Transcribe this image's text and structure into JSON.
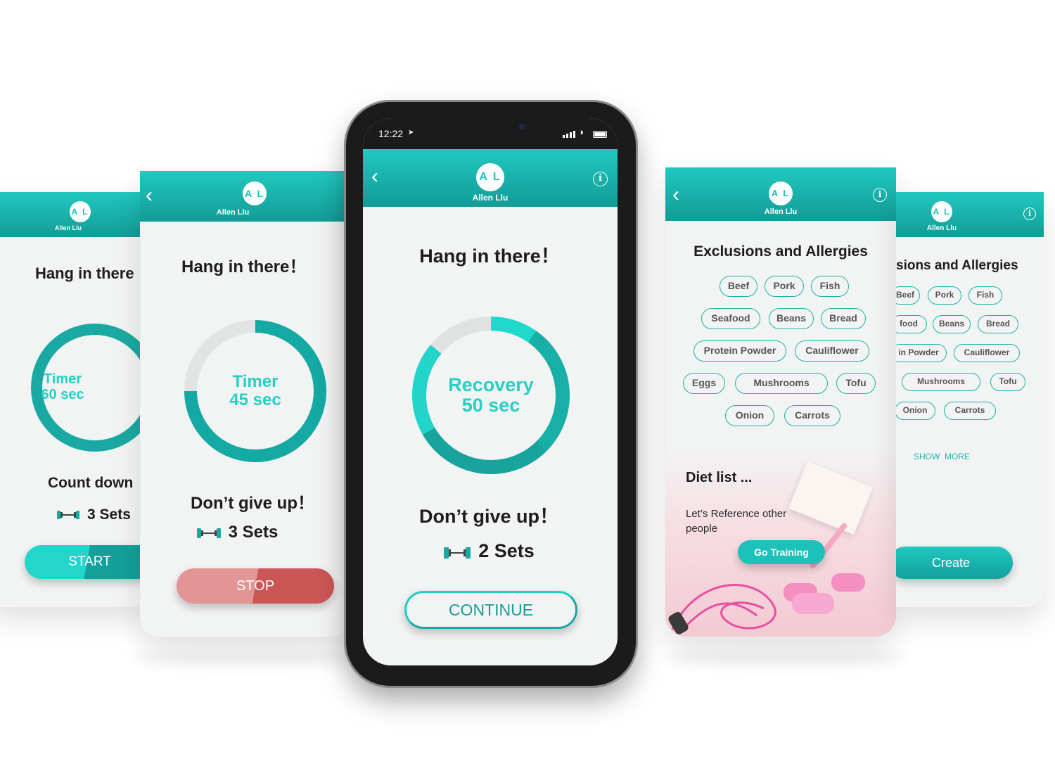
{
  "user": {
    "initials": "A L",
    "name": "Allen Llu"
  },
  "status_bar": {
    "time": "12:22"
  },
  "screen_far_left": {
    "title": "Hang in there",
    "ring": {
      "line1": "Timer",
      "line2": "60 sec",
      "progress": 1.0
    },
    "subtitle": "Count down",
    "sets": "3 Sets",
    "button": "START"
  },
  "screen_left": {
    "title": "Hang in there！",
    "ring": {
      "line1": "Timer",
      "line2": "45 sec",
      "progress": 0.75
    },
    "subtitle": "Don’t give up！",
    "sets": "3 Sets",
    "button": "STOP"
  },
  "screen_center": {
    "title": "Hang in there！",
    "ring": {
      "line1": "Recovery",
      "line2": "50 sec",
      "progress": 0.86
    },
    "subtitle": "Don’t give up！",
    "sets": "2 Sets",
    "button": "CONTINUE"
  },
  "screen_right": {
    "title": "Exclusions and Allergies",
    "tags": [
      "Beef",
      "Pork",
      "Fish",
      "Seafood",
      "Beans",
      "Bread",
      "Protein Powder",
      "Cauliflower",
      "Eggs",
      "Mushrooms",
      "Tofu",
      "Onion",
      "Carrots"
    ],
    "diet_title": "Diet list ...",
    "diet_text": "Let’s Reference other people",
    "diet_button": "Go Training"
  },
  "screen_far_right": {
    "title": "sions and Allergies",
    "tags": [
      "Beef",
      "Pork",
      "Fish",
      "food",
      "Beans",
      "Bread",
      "in Powder",
      "Cauliflower",
      "Mushrooms",
      "Tofu",
      "Onion",
      "Carrots"
    ],
    "show_more": "SHOW  MORE",
    "button": "Create"
  },
  "colors": {
    "teal": "#1cc2ba",
    "teal_dark": "#139b96",
    "stop": "#e07878"
  }
}
